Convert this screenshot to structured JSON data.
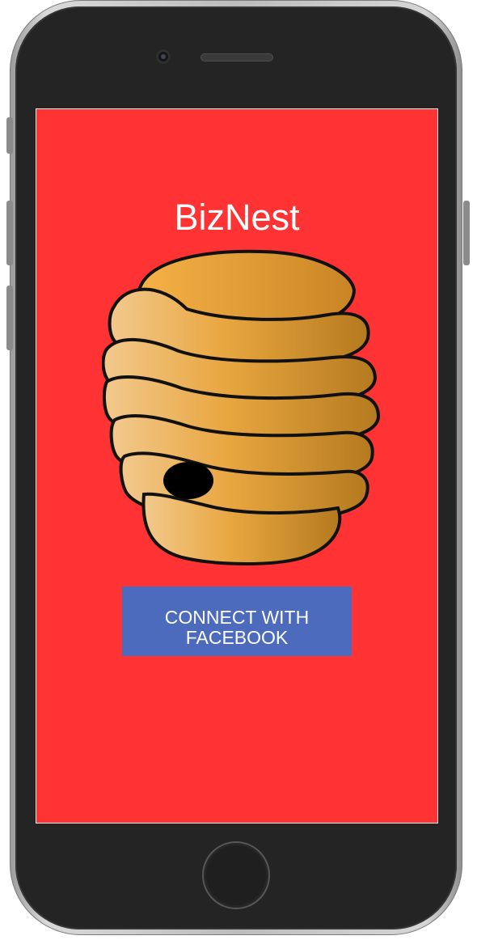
{
  "app": {
    "title": "BizNest"
  },
  "login": {
    "connect_button_label": "CONNECT WITH\nFACEBOOK"
  },
  "assets": {
    "hero_image": "beehive-icon",
    "device_frame": "smartphone-frame"
  },
  "colors": {
    "screen_background": "#ff3333",
    "title_text": "#ffffff",
    "button_background": "#4c6bbd",
    "button_text": "#ffffff",
    "hive_outline": "#111111",
    "hive_fill": "#e3a443"
  }
}
